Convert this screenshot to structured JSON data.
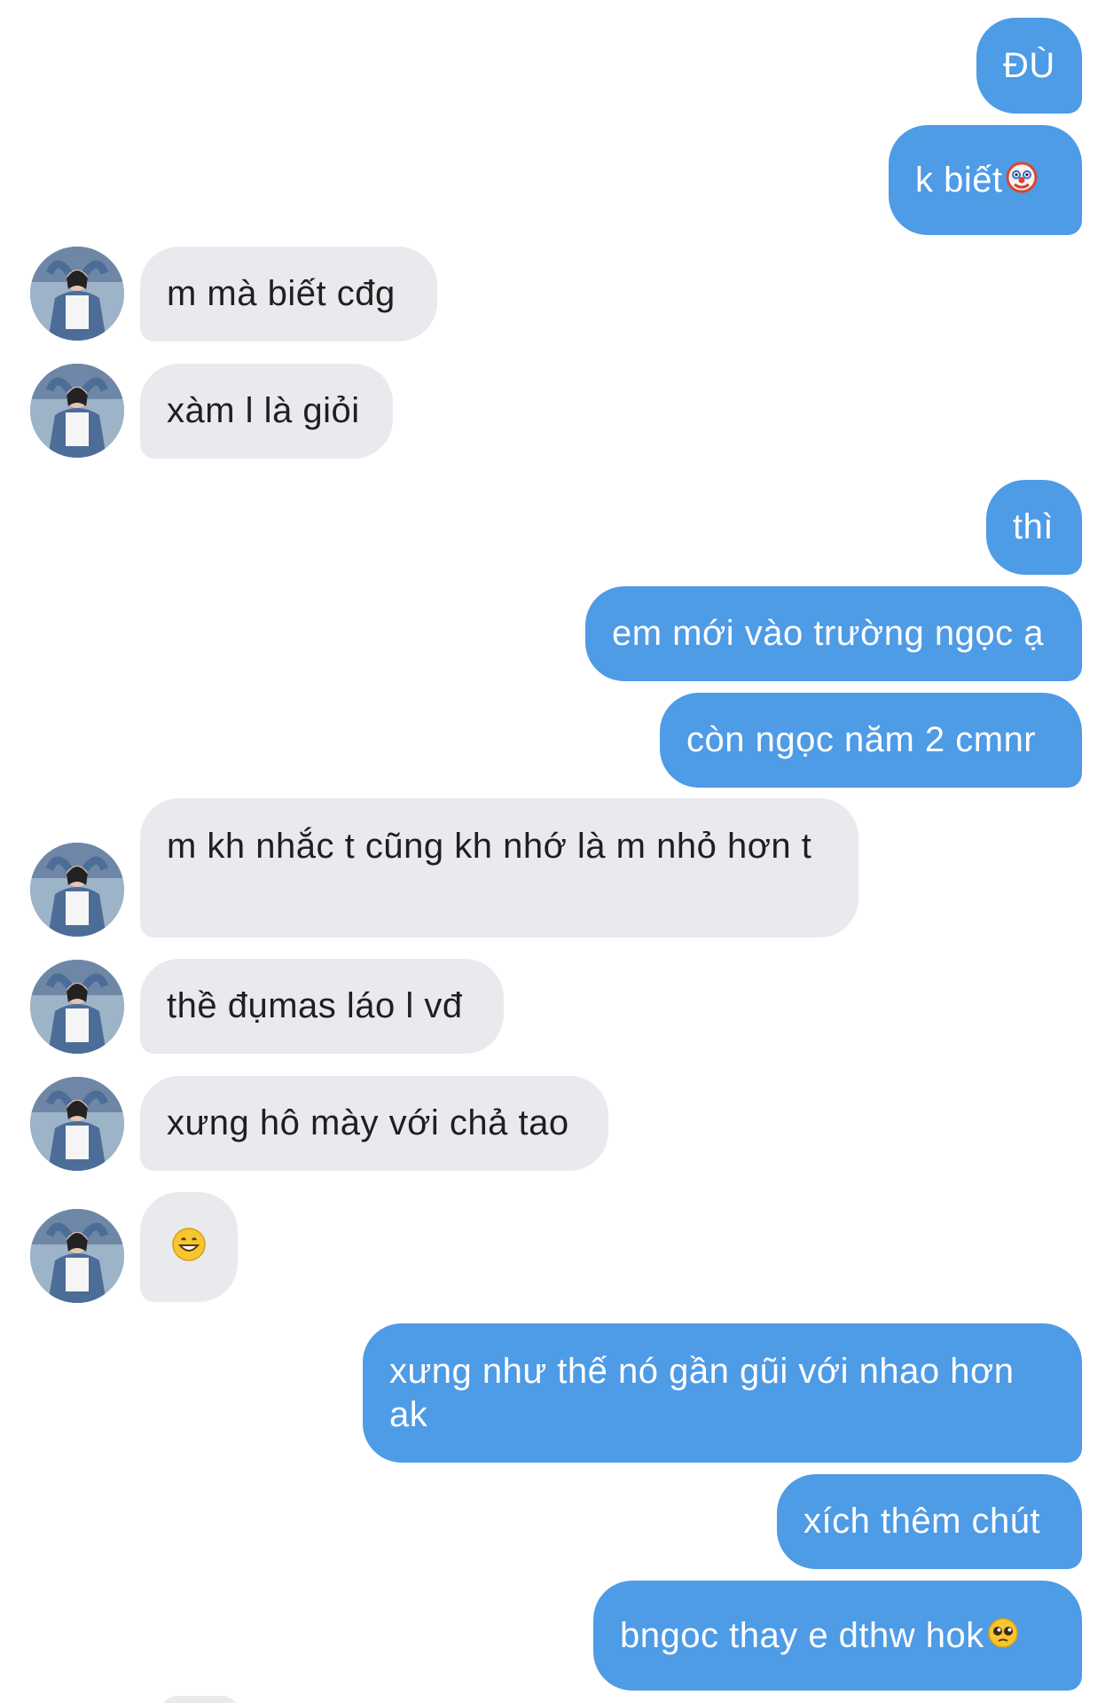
{
  "conversation": {
    "messages": [
      {
        "id": "m1",
        "direction": "sent",
        "text": "ĐÙ"
      },
      {
        "id": "m2",
        "direction": "sent",
        "text": "k biết",
        "emoji_icon": "clown-face-emoji"
      },
      {
        "id": "m3",
        "direction": "received",
        "text": "m mà biết cđg"
      },
      {
        "id": "m4",
        "direction": "received",
        "text": "xàm l là giỏi"
      },
      {
        "id": "m5",
        "direction": "sent",
        "text": "thì"
      },
      {
        "id": "m6",
        "direction": "sent",
        "text": "em mới vào trường ngọc ạ"
      },
      {
        "id": "m7",
        "direction": "sent",
        "text": "còn ngọc năm 2 cmnr"
      },
      {
        "id": "m8",
        "direction": "received",
        "text": "m kh nhắc t cũng kh nhớ là m nhỏ hơn t"
      },
      {
        "id": "m9",
        "direction": "received",
        "text": "thề đụmas láo l vđ"
      },
      {
        "id": "m10",
        "direction": "received",
        "text": "xưng hô mày với chả tao"
      },
      {
        "id": "m11",
        "direction": "received",
        "text": "",
        "emoji_icon": "grinning-face-emoji"
      },
      {
        "id": "m12",
        "direction": "sent",
        "text": "xưng như thế nó gần gũi với nhao hơn ak"
      },
      {
        "id": "m13",
        "direction": "sent",
        "text": "xích thêm chút"
      },
      {
        "id": "m14",
        "direction": "sent",
        "text": "bngoc thay e dthw hok",
        "emoji_icon": "pleading-face-emoji"
      }
    ]
  },
  "colors": {
    "sent_bubble": "#4e9be6",
    "received_bubble": "#e9eaee",
    "sent_text": "#ffffff",
    "received_text": "#1f1f1f"
  }
}
